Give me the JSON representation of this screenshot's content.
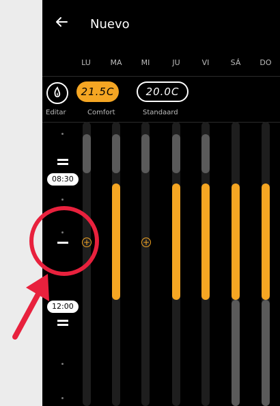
{
  "header": {
    "title": "Nuevo",
    "back_icon": "arrow-left-icon"
  },
  "days": [
    "LU",
    "MA",
    "MI",
    "JU",
    "VI",
    "SÁ",
    "DO"
  ],
  "modes": {
    "edit_label": "Editar",
    "comfort": {
      "value": "21.5C",
      "label": "Comfort",
      "color": "#f5a623"
    },
    "standard": {
      "value": "20.0C",
      "label": "Standaard"
    }
  },
  "timeline": {
    "start_time": "08:30",
    "end_time": "12:00"
  },
  "colors": {
    "accent": "#f5a623",
    "annotation": "#e8213d",
    "background": "#000000"
  }
}
